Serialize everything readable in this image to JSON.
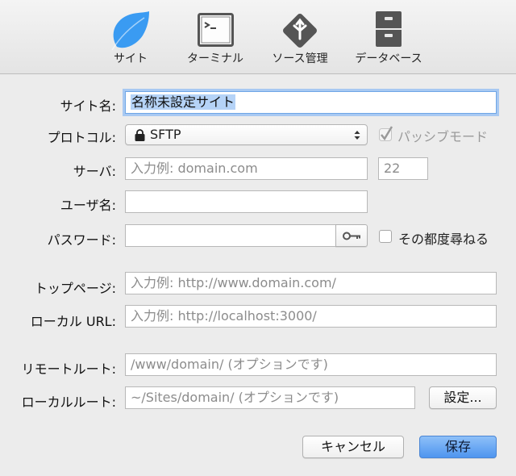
{
  "toolbar": {
    "items": [
      {
        "label": "サイト",
        "icon": "leaf-icon",
        "active": true
      },
      {
        "label": "ターミナル",
        "icon": "terminal-icon"
      },
      {
        "label": "ソース管理",
        "icon": "source-control-icon"
      },
      {
        "label": "データベース",
        "icon": "database-icon"
      }
    ]
  },
  "form": {
    "site_name": {
      "label": "サイト名:",
      "value": "名称未設定サイト"
    },
    "protocol": {
      "label": "プロトコル:",
      "value": "SFTP",
      "options_icon": "lock-icon"
    },
    "passive_mode": {
      "label": "パッシブモード",
      "checked": true,
      "disabled": true
    },
    "server": {
      "label": "サーバ:",
      "placeholder": "入力例: domain.com",
      "port": "22"
    },
    "username": {
      "label": "ユーザ名:",
      "value": ""
    },
    "password": {
      "label": "パスワード:",
      "value": "",
      "key_icon": "key-icon"
    },
    "ask_each_time": {
      "label": "その都度尋ねる",
      "checked": false
    },
    "top_page": {
      "label": "トップページ:",
      "placeholder": "入力例: http://www.domain.com/"
    },
    "local_url": {
      "label": "ローカル URL:",
      "placeholder": "入力例: http://localhost:3000/"
    },
    "remote_root": {
      "label": "リモートルート:",
      "placeholder": "/www/domain/ (オプションです)"
    },
    "local_root": {
      "label": "ローカルルート:",
      "placeholder": "~/Sites/domain/ (オプションです)",
      "settings_button": "設定..."
    }
  },
  "actions": {
    "cancel": "キャンセル",
    "save": "保存"
  },
  "colors": {
    "accent": "#4e95ef",
    "leaf": "#3a9bf2",
    "icon_gray": "#555555"
  }
}
